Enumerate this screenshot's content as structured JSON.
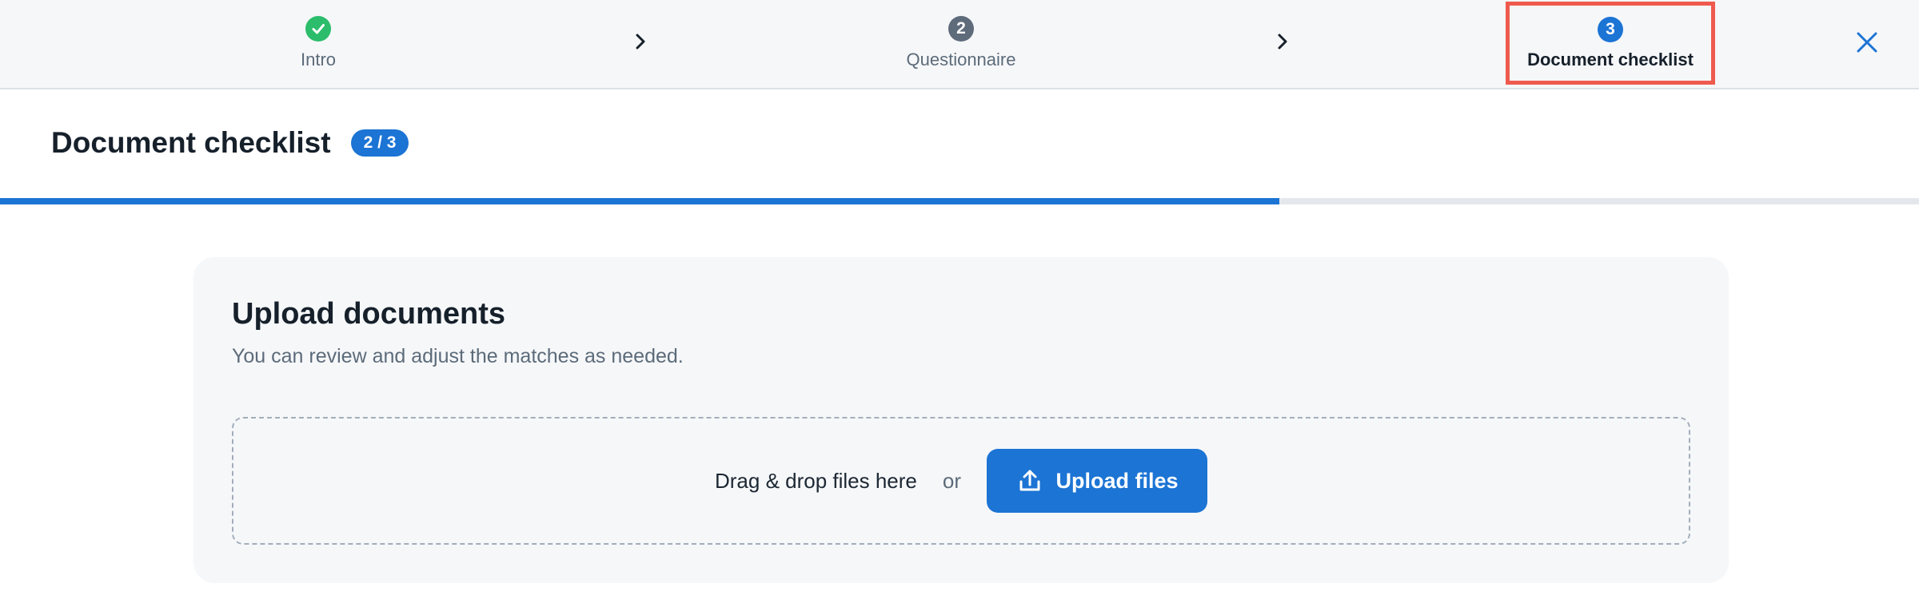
{
  "stepper": {
    "steps": [
      {
        "label": "Intro",
        "number": "",
        "status": "done",
        "icon": "check-icon"
      },
      {
        "label": "Questionnaire",
        "number": "2",
        "status": "inactive"
      },
      {
        "label": "Document checklist",
        "number": "3",
        "status": "active"
      }
    ],
    "separator_icon": "chevron-right-icon",
    "close_icon": "close-icon"
  },
  "page": {
    "title": "Document checklist",
    "progress_badge": "2 / 3",
    "progress_fraction": 0.6667
  },
  "upload": {
    "title": "Upload documents",
    "subtitle": "You can review and adjust the matches as needed.",
    "dropzone_text": "Drag & drop files here",
    "or_text": "or",
    "button_label": "Upload files",
    "button_icon": "upload-icon"
  },
  "colors": {
    "accent": "#1c74d4",
    "success": "#2bbd6b",
    "highlight_border": "#ef5a4e"
  }
}
